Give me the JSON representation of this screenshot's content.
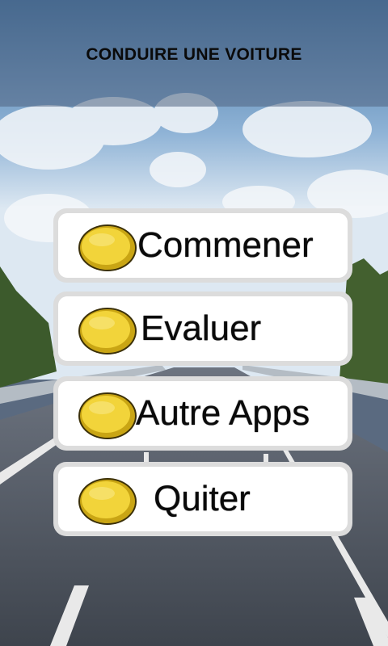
{
  "header": {
    "title": "CONDUIRE UNE VOITURE"
  },
  "menu": {
    "items": [
      {
        "label": "Commener",
        "icon": "gold-coin-icon"
      },
      {
        "label": "Evaluer",
        "icon": "gold-coin-icon"
      },
      {
        "label": "Autre Apps",
        "icon": "gold-coin-icon"
      },
      {
        "label": "Quiter",
        "icon": "gold-coin-icon"
      }
    ]
  },
  "colors": {
    "coin": "#f2d43a",
    "coin_rim": "#c9a514",
    "button_border": "#dcdcdc",
    "button_face": "#ffffff"
  }
}
